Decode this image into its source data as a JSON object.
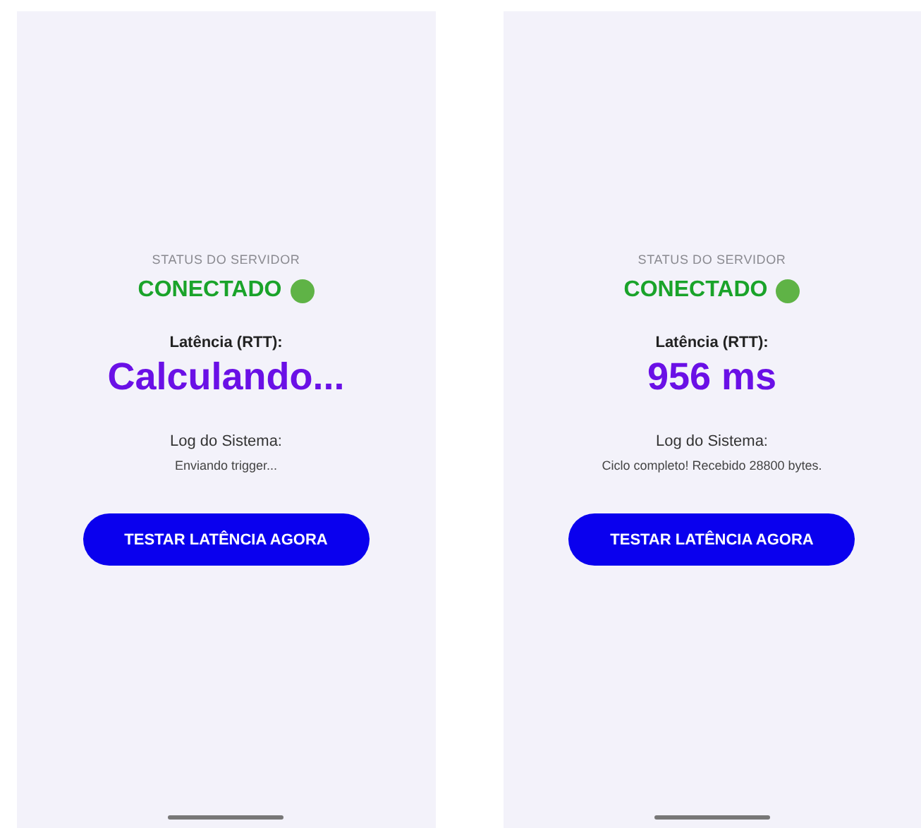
{
  "screens": [
    {
      "status_label": "STATUS DO SERVIDOR",
      "status": "CONECTADO",
      "latency_label": "Latência (RTT):",
      "latency": "Calculando...",
      "log_label": "Log do Sistema:",
      "log": "Enviando trigger...",
      "button": "TESTAR LATÊNCIA AGORA"
    },
    {
      "status_label": "STATUS DO SERVIDOR",
      "status": "CONECTADO",
      "latency_label": "Latência (RTT):",
      "latency": "956 ms",
      "log_label": "Log do Sistema:",
      "log": "Ciclo completo! Recebido 28800 bytes.",
      "button": "TESTAR LATÊNCIA AGORA"
    }
  ]
}
